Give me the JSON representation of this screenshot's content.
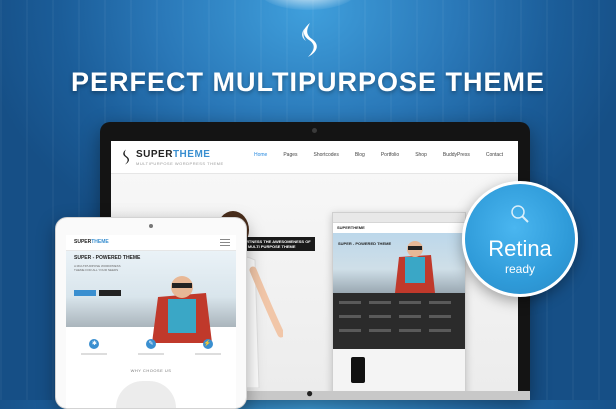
{
  "headline": "PERFECT MULTIPURPOSE THEME",
  "site": {
    "logo_super": "SUPER",
    "logo_theme": "THEME",
    "tagline": "MULTIPURPOSE WORDPRESS THEME",
    "nav": [
      "Home",
      "Pages",
      "Shortcodes",
      "Blog",
      "Portfolio",
      "Shop",
      "BuddyPress",
      "Contact"
    ],
    "active_nav": "Home",
    "hero_tag_line1": "WITNESS THE AWESOMENESS OF",
    "hero_tag_line2": "A MULTI PURPOSE THEME"
  },
  "browser": {
    "logo": "SUPERTHEME",
    "hero_title": "SUPER - POWERED THEME"
  },
  "tablet": {
    "logo_super": "SUPER",
    "logo_theme": "THEME",
    "hero_title": "SUPER - POWERED THEME",
    "hero_sub": "A MULTIPURPOSE WORDPRESS THEME FOR ALL YOUR NEEDS",
    "why_title": "WHY CHOOSE US"
  },
  "badge": {
    "title": "Retina",
    "subtitle": "ready"
  },
  "colors": {
    "accent": "#3a8fd0",
    "background": "#1b5d99",
    "badge": "#2f9bd9"
  }
}
